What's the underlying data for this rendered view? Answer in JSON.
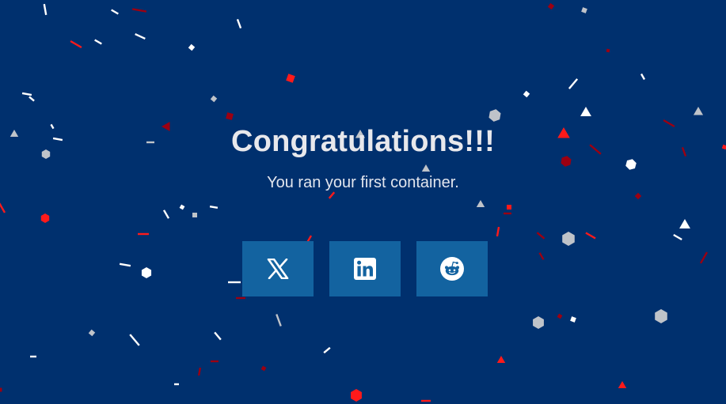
{
  "page": {
    "title": "Congratulations!!!",
    "subtitle": "You ran your first container."
  },
  "share_buttons": [
    {
      "icon": "x-logo-icon"
    },
    {
      "icon": "linkedin-logo-icon"
    },
    {
      "icon": "reddit-logo-icon"
    }
  ],
  "colors": {
    "background": "#00306e",
    "button": "#1363a0",
    "text": "#e8e8ec",
    "confetti_red": "#ff1a1a",
    "confetti_dark_red": "#9b0012",
    "confetti_white": "#ffffff",
    "confetti_gray": "#bfc3c9"
  }
}
